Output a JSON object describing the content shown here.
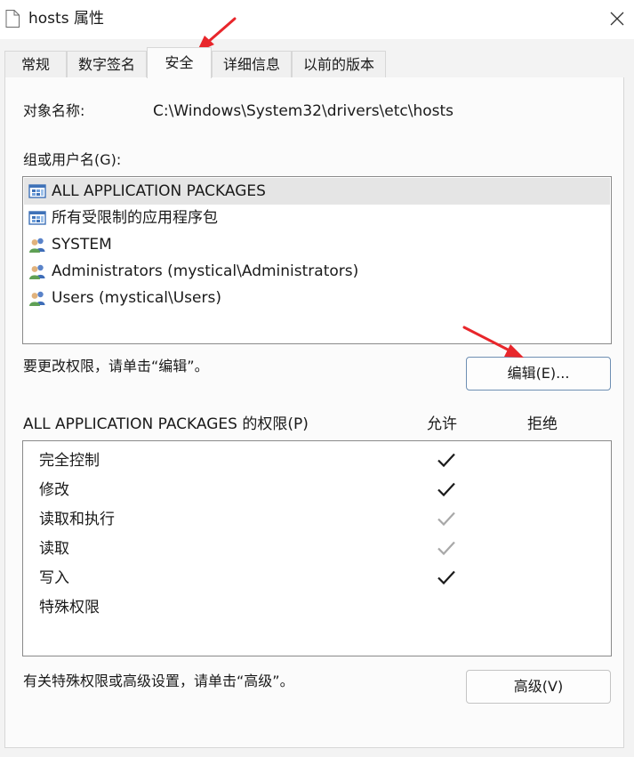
{
  "window": {
    "title": "hosts 属性",
    "close_glyph": "✕"
  },
  "tabs": [
    {
      "label": "常规",
      "active": false
    },
    {
      "label": "数字签名",
      "active": false
    },
    {
      "label": "安全",
      "active": true
    },
    {
      "label": "详细信息",
      "active": false
    },
    {
      "label": "以前的版本",
      "active": false
    }
  ],
  "security": {
    "object_name_label": "对象名称:",
    "object_name_value": "C:\\Windows\\System32\\drivers\\etc\\hosts",
    "groups_label": "组或用户名(G):",
    "groups": [
      {
        "name": "ALL APPLICATION PACKAGES",
        "icon": "app-packages-icon",
        "selected": true
      },
      {
        "name": "所有受限制的应用程序包",
        "icon": "app-packages-icon",
        "selected": false
      },
      {
        "name": "SYSTEM",
        "icon": "users-group-icon",
        "selected": false
      },
      {
        "name": "Administrators (mystical\\Administrators)",
        "icon": "users-group-icon",
        "selected": false
      },
      {
        "name": "Users (mystical\\Users)",
        "icon": "users-group-icon",
        "selected": false
      }
    ],
    "change_hint": "要更改权限，请单击“编辑”。",
    "edit_button": "编辑(E)...",
    "permissions_label": "ALL APPLICATION PACKAGES 的权限(P)",
    "allow_header": "允许",
    "deny_header": "拒绝",
    "permissions": [
      {
        "name": "完全控制",
        "allow": "explicit"
      },
      {
        "name": "修改",
        "allow": "explicit"
      },
      {
        "name": "读取和执行",
        "allow": "inherited"
      },
      {
        "name": "读取",
        "allow": "inherited"
      },
      {
        "name": "写入",
        "allow": "explicit"
      },
      {
        "name": "特殊权限",
        "allow": "none"
      }
    ],
    "advanced_hint": "有关特殊权限或高级设置，请单击“高级”。",
    "advanced_button": "高级(V)"
  },
  "colors": {
    "annotation_arrow": "#e8262b",
    "check_explicit": "#1a1a1a",
    "check_inherited": "#a8a8a8"
  }
}
